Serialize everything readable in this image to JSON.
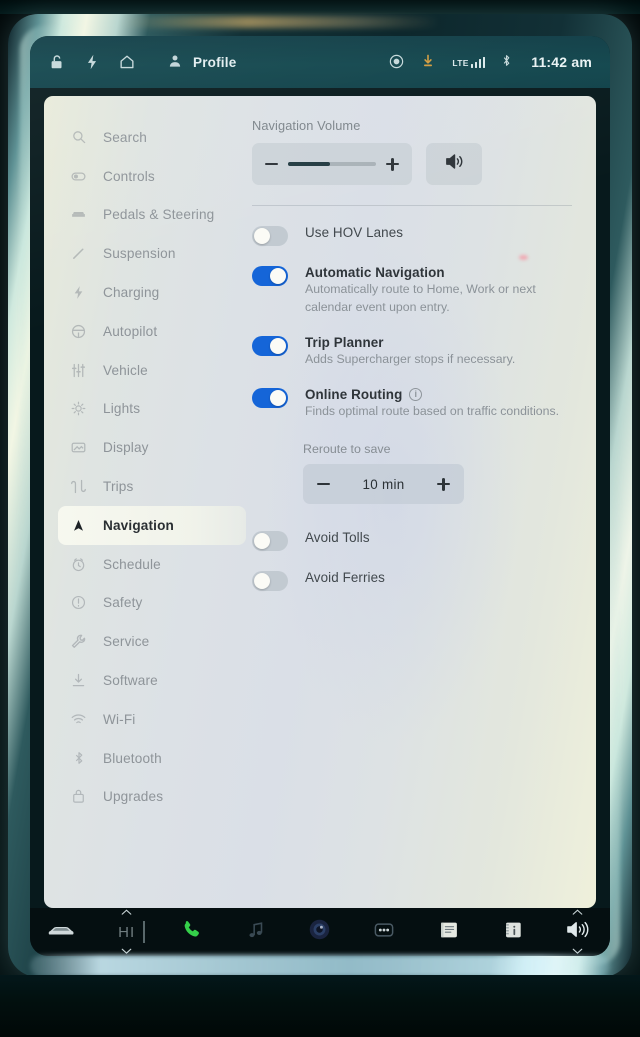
{
  "statusbar": {
    "left_icons": [
      {
        "name": "lock-icon",
        "glyph": "lock"
      },
      {
        "name": "bolt-icon",
        "glyph": "bolt"
      },
      {
        "name": "home-icon",
        "glyph": "home"
      }
    ],
    "profile_label": "Profile",
    "profile_icon": "person-icon",
    "right_icons": [
      {
        "name": "recording-circle-icon",
        "glyph": "circle-dot"
      },
      {
        "name": "download-icon",
        "glyph": "download",
        "color": "#e2a33c"
      },
      {
        "name": "cellular-signal-icon",
        "glyph": "signal-bars"
      },
      {
        "name": "bluetooth-icon",
        "glyph": "bluetooth"
      }
    ],
    "network_label": "LTE",
    "time": "11:42 am"
  },
  "sidebar": {
    "items": [
      {
        "label": "Search",
        "icon": "search-icon",
        "active": false
      },
      {
        "label": "Controls",
        "icon": "controls-toggle-icon",
        "active": false
      },
      {
        "label": "Pedals & Steering",
        "icon": "pedals-steering-icon",
        "active": false
      },
      {
        "label": "Suspension",
        "icon": "suspension-icon",
        "active": false
      },
      {
        "label": "Charging",
        "icon": "charging-bolt-icon",
        "active": false
      },
      {
        "label": "Autopilot",
        "icon": "steering-wheel-icon",
        "active": false
      },
      {
        "label": "Vehicle",
        "icon": "sliders-icon",
        "active": false
      },
      {
        "label": "Lights",
        "icon": "lights-icon",
        "active": false
      },
      {
        "label": "Display",
        "icon": "display-icon",
        "active": false
      },
      {
        "label": "Trips",
        "icon": "trips-icon",
        "active": false
      },
      {
        "label": "Navigation",
        "icon": "navigation-arrow-icon",
        "active": true
      },
      {
        "label": "Schedule",
        "icon": "clock-icon",
        "active": false
      },
      {
        "label": "Safety",
        "icon": "safety-alert-icon",
        "active": false
      },
      {
        "label": "Service",
        "icon": "wrench-icon",
        "active": false
      },
      {
        "label": "Software",
        "icon": "software-download-icon",
        "active": false
      },
      {
        "label": "Wi-Fi",
        "icon": "wifi-icon",
        "active": false
      },
      {
        "label": "Bluetooth",
        "icon": "bluetooth-icon",
        "active": false
      },
      {
        "label": "Upgrades",
        "icon": "upgrades-bag-icon",
        "active": false
      }
    ]
  },
  "main": {
    "volume": {
      "title": "Navigation Volume",
      "level_percent": 48,
      "decrease_icon": "minus-icon",
      "increase_icon": "plus-icon",
      "mute_icon": "speaker-icon"
    },
    "toggles": [
      {
        "title": "Use HOV Lanes",
        "desc": "",
        "state": "off",
        "bold": false,
        "info": false
      },
      {
        "title": "Automatic Navigation",
        "desc": "Automatically route to Home, Work or next calendar event upon entry.",
        "state": "on",
        "bold": true,
        "info": false
      },
      {
        "title": "Trip Planner",
        "desc": "Adds Supercharger stops if necessary.",
        "state": "on",
        "bold": true,
        "info": false
      },
      {
        "title": "Online Routing",
        "desc": "Finds optimal route based on traffic conditions.",
        "state": "on",
        "bold": true,
        "info": true,
        "info_icon": "info-icon"
      }
    ],
    "reroute": {
      "label": "Reroute to save",
      "value": "10  min",
      "decrease_icon": "minus-icon",
      "increase_icon": "plus-icon"
    },
    "toggles_bottom": [
      {
        "title": "Avoid Tolls",
        "state": "off"
      },
      {
        "title": "Avoid Ferries",
        "state": "off"
      }
    ]
  },
  "taskbar": {
    "items": [
      {
        "name": "car-icon",
        "label": ""
      },
      {
        "name": "climate-icon",
        "label": "HI"
      },
      {
        "name": "phone-icon",
        "label": ""
      },
      {
        "name": "media-music-icon",
        "label": ""
      },
      {
        "name": "camera-icon",
        "label": ""
      },
      {
        "name": "more-apps-icon",
        "label": ""
      },
      {
        "name": "notes-icon",
        "label": ""
      },
      {
        "name": "manual-info-icon",
        "label": ""
      },
      {
        "name": "volume-speaker-icon",
        "label": ""
      }
    ]
  },
  "colors": {
    "accent_blue": "#1565d8",
    "statusbar_teal": "#10454c",
    "card_bg": "#dde2e4",
    "download_amber": "#e2a33c",
    "phone_green": "#35d04a"
  }
}
